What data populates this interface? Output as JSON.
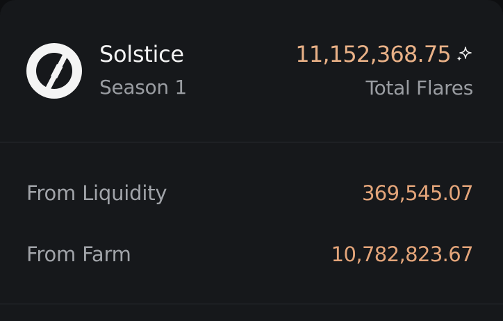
{
  "project": {
    "name": "Solstice",
    "season": "Season 1",
    "logo_icon": "solstice-logo-icon"
  },
  "totals": {
    "value": "11,152,368.75",
    "label": "Total Flares",
    "sparkle_icon": "sparkle-icon"
  },
  "breakdown": [
    {
      "label": "From Liquidity",
      "value": "369,545.07"
    },
    {
      "label": "From Farm",
      "value": "10,782,823.67"
    }
  ],
  "colors": {
    "background": "#16181b",
    "accent": "#e9b187",
    "primary_text": "#f3f3f3",
    "secondary_text": "#9a9da2",
    "divider": "#2a2d31"
  }
}
